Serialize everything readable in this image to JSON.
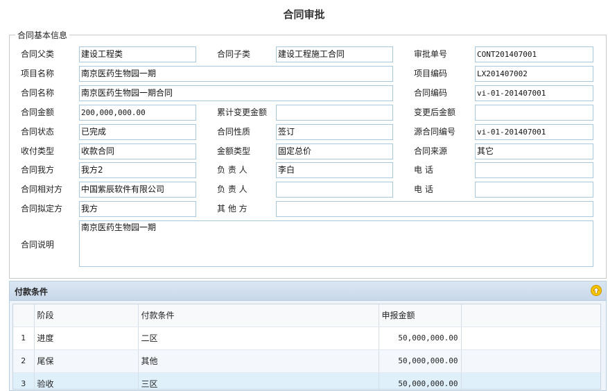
{
  "page_title": "合同审批",
  "basic_info": {
    "legend": "合同基本信息",
    "labels": {
      "contract_parent_type": "合同父类",
      "contract_sub_type": "合同子类",
      "approval_no": "审批单号",
      "project_name": "项目名称",
      "project_code": "项目编码",
      "contract_name": "合同名称",
      "contract_code": "合同编码",
      "contract_amount": "合同金额",
      "cumulative_change": "累计变更金额",
      "changed_amount": "变更后金额",
      "contract_status": "合同状态",
      "contract_nature": "合同性质",
      "source_contract_no": "源合同编号",
      "payment_type": "收付类型",
      "amount_type": "金额类型",
      "contract_source": "合同来源",
      "our_party": "合同我方",
      "principal_1": "负 责 人",
      "phone_1": "电    话",
      "counterparty": "合同相对方",
      "principal_2": "负 责 人",
      "phone_2": "电    话",
      "drafter": "合同拟定方",
      "other_party": "其 他 方",
      "description": "合同说明"
    },
    "values": {
      "contract_parent_type": "建设工程类",
      "contract_sub_type": "建设工程施工合同",
      "approval_no": "CONT201407001",
      "project_name": "南京医药生物园一期",
      "project_code": "LX201407002",
      "contract_name": "南京医药生物园一期合同",
      "contract_code": "vi-01-201407001",
      "contract_amount": "200,000,000.00",
      "cumulative_change": "",
      "changed_amount": "",
      "contract_status": "已完成",
      "contract_nature": "签订",
      "source_contract_no": "vi-01-201407001",
      "payment_type": "收款合同",
      "amount_type": "固定总价",
      "contract_source": "其它",
      "our_party": "我方2",
      "principal_1": "李白",
      "phone_1": "",
      "counterparty": "中国紫辰软件有限公司",
      "principal_2": "",
      "phone_2": "",
      "drafter": "我方",
      "other_party": "",
      "description": "南京医药生物园一期"
    }
  },
  "payment": {
    "title": "付款条件",
    "collapse_icon": "arrow-up-icon",
    "columns": [
      "阶段",
      "付款条件",
      "申报金额"
    ],
    "rows": [
      {
        "idx": "1",
        "stage": "进度",
        "condition": "二区",
        "amount": "50,000,000.00"
      },
      {
        "idx": "2",
        "stage": "尾保",
        "condition": "其他",
        "amount": "50,000,000.00"
      },
      {
        "idx": "3",
        "stage": "验收",
        "condition": "三区",
        "amount": "50,000,000.00"
      }
    ]
  },
  "colors": {
    "field_border": "#a8c8e0",
    "panel_header": "#c8d8ea",
    "selected_row": "#dff0fb"
  }
}
